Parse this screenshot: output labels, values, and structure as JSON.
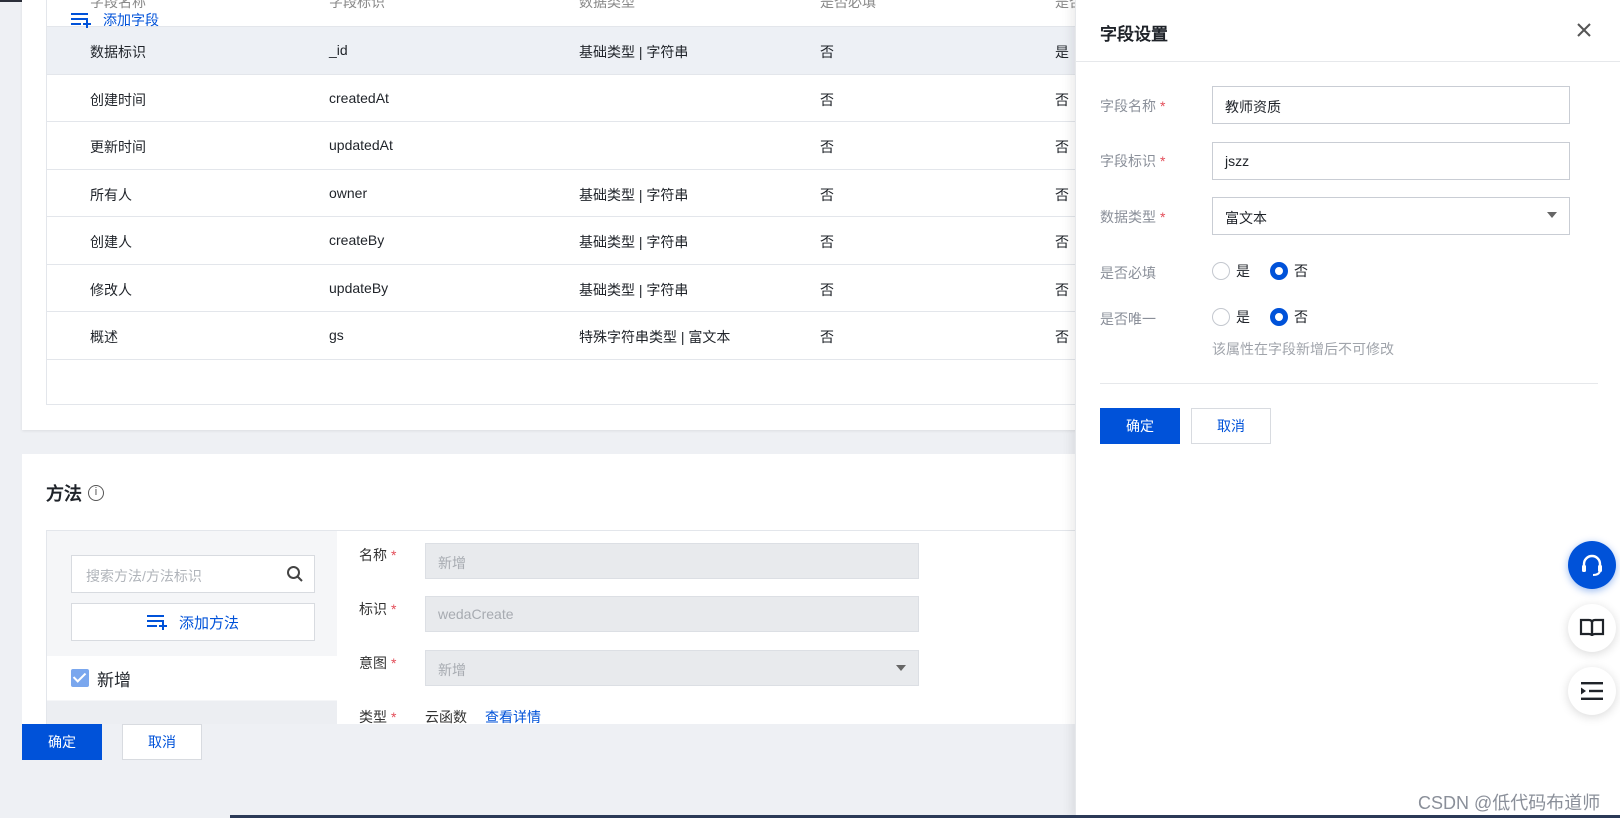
{
  "table": {
    "headers": [
      "字段名称",
      "字段标识",
      "数据类型",
      "是否必填",
      "是否"
    ],
    "rows": [
      {
        "name": "数据标识",
        "key": "_id",
        "type": "基础类型 | 字符串",
        "required": "否",
        "unique": "是"
      },
      {
        "name": "创建时间",
        "key": "createdAt",
        "type": "",
        "required": "否",
        "unique": "否"
      },
      {
        "name": "更新时间",
        "key": "updatedAt",
        "type": "",
        "required": "否",
        "unique": "否"
      },
      {
        "name": "所有人",
        "key": "owner",
        "type": "基础类型 | 字符串",
        "required": "否",
        "unique": "否"
      },
      {
        "name": "创建人",
        "key": "createBy",
        "type": "基础类型 | 字符串",
        "required": "否",
        "unique": "否"
      },
      {
        "name": "修改人",
        "key": "updateBy",
        "type": "基础类型 | 字符串",
        "required": "否",
        "unique": "否"
      },
      {
        "name": "概述",
        "key": "gs",
        "type": "特殊字符串类型 | 富文本",
        "required": "否",
        "unique": "否"
      }
    ],
    "add_field_label": "添加字段"
  },
  "methods": {
    "title": "方法",
    "info_glyph": "i",
    "search_placeholder": "搜索方法/方法标识",
    "add_method_label": "添加方法",
    "selected_item": "新增",
    "form": {
      "name_label": "名称",
      "name_value": "新增",
      "key_label": "标识",
      "key_value": "wedaCreate",
      "intent_label": "意图",
      "intent_value": "新增",
      "type_label": "类型",
      "type_value": "云函数",
      "view_detail": "查看详情"
    },
    "required_mark": "*"
  },
  "bottom_bar": {
    "confirm": "确定",
    "cancel": "取消"
  },
  "drawer": {
    "title": "字段设置",
    "field_name_label": "字段名称",
    "field_name_value": "教师资质",
    "field_key_label": "字段标识",
    "field_key_value": "jszz",
    "data_type_label": "数据类型",
    "data_type_value": "富文本",
    "required_label": "是否必填",
    "unique_label": "是否唯一",
    "option_yes": "是",
    "option_no": "否",
    "required_selected": "否",
    "unique_selected": "否",
    "hint": "该属性在字段新增后不可修改",
    "confirm": "确定",
    "cancel": "取消",
    "required_mark": "*"
  },
  "floating": [
    "headset-icon",
    "book-icon",
    "menu-indent-icon"
  ],
  "watermark": "CSDN @低代码布道师",
  "colors": {
    "primary": "#0052d9",
    "required": "#e34d59"
  }
}
